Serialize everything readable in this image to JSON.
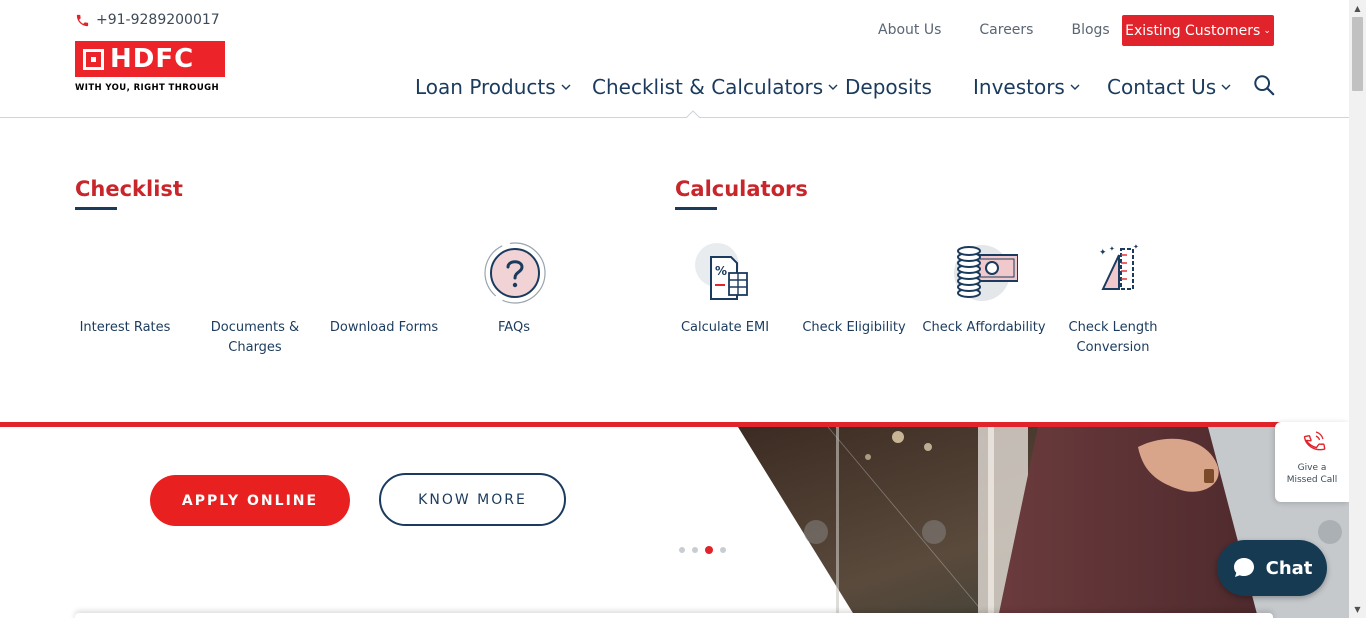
{
  "header": {
    "phone": "+91-9289200017",
    "logo_text": "HDFC",
    "logo_tagline": "WITH YOU, RIGHT THROUGH",
    "top_links": [
      "About Us",
      "Careers",
      "Blogs"
    ],
    "existing_customers": "Existing Customers",
    "nav": [
      "Loan Products",
      "Checklist & Calculators",
      "Deposits",
      "Investors",
      "Contact Us"
    ]
  },
  "mega_menu": {
    "checklist_title": "Checklist",
    "calculators_title": "Calculators",
    "checklist_items": [
      {
        "label": "Interest Rates",
        "icon": "interest-rates-icon"
      },
      {
        "label": "Documents & Charges",
        "icon": "documents-icon"
      },
      {
        "label": "Download Forms",
        "icon": "download-forms-icon"
      },
      {
        "label": "FAQs",
        "icon": "question-icon"
      }
    ],
    "calculator_items": [
      {
        "label": "Calculate EMI",
        "icon": "emi-calculator-icon"
      },
      {
        "label": "Check Eligibility",
        "icon": "eligibility-icon"
      },
      {
        "label": "Check Affordability",
        "icon": "coins-cash-icon"
      },
      {
        "label": "Check Length Conversion",
        "icon": "ruler-triangle-icon"
      }
    ]
  },
  "hero": {
    "apply_label": "APPLY ONLINE",
    "know_more_label": "KNOW MORE",
    "slide_active": 3,
    "slide_count": 4
  },
  "missed_call": {
    "line1": "Give a",
    "line2": "Missed Call"
  },
  "chat_label": "Chat",
  "colors": {
    "brand_red": "#e1242b",
    "navy": "#1b3b5e",
    "chat_bg": "#173a53"
  }
}
